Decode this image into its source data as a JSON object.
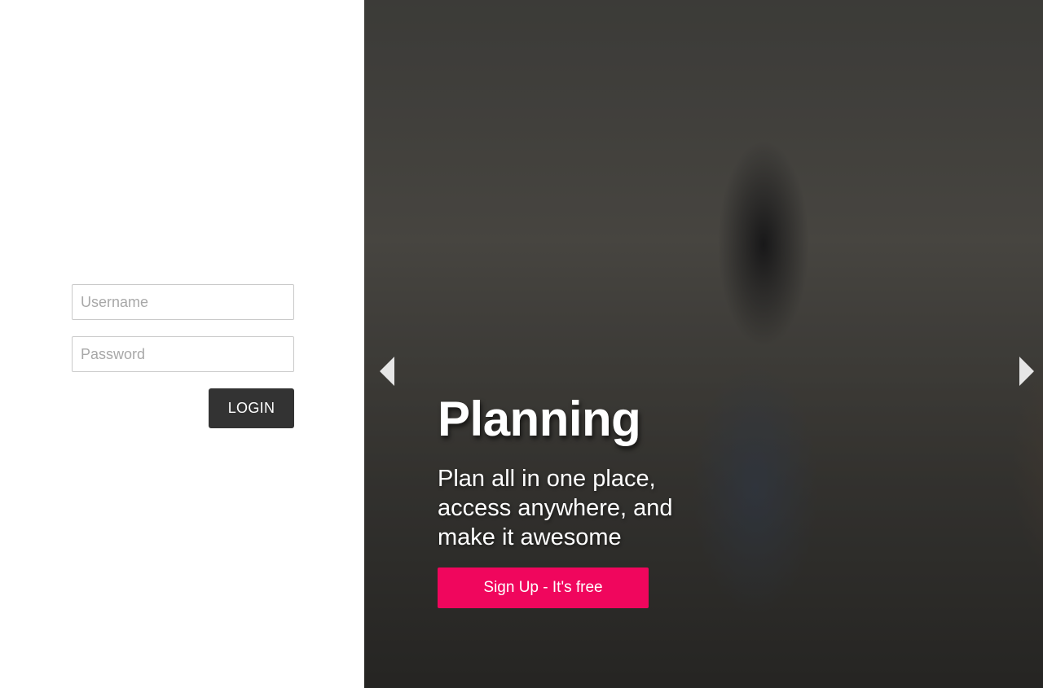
{
  "login": {
    "username_placeholder": "Username",
    "password_placeholder": "Password",
    "login_label": "LOGIN"
  },
  "hero": {
    "title": "Planning",
    "subtitle": "Plan all in one place, access anywhere, and make it awesome",
    "signup_label": "Sign Up - It's free",
    "prev_icon": "triangle-left-icon",
    "next_icon": "triangle-right-icon"
  },
  "colors": {
    "signup_bg": "#f0065d",
    "login_bg": "#333333",
    "panel_bg": "#ffffff"
  }
}
